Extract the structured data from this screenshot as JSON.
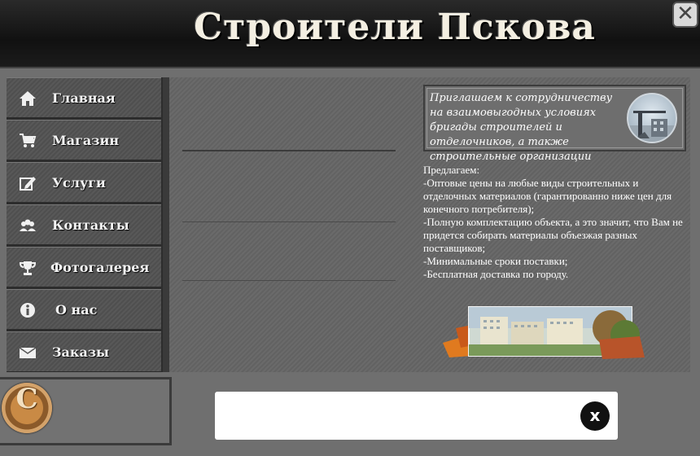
{
  "header": {
    "title": "Строители Пскова",
    "close_symbol": "✕"
  },
  "menu": [
    {
      "label": "Главная",
      "icon": "home-icon"
    },
    {
      "label": "Магазин",
      "icon": "cart-icon"
    },
    {
      "label": "Услуги",
      "icon": "edit-icon"
    },
    {
      "label": "Контакты",
      "icon": "users-icon"
    },
    {
      "label": "Фотогалерея",
      "icon": "trophy-icon"
    },
    {
      "label": "О нас",
      "icon": "info-icon"
    },
    {
      "label": "Заказы",
      "icon": "envelope-icon"
    }
  ],
  "invite": {
    "text": "Приглашаем к сотрудничеству на взаимовыгодных условиях бригады строителей и отделочников, а также строительные организации"
  },
  "offer": {
    "lines": [
      "Предлагаем:",
      "-Оптовые цены на любые виды строительных и отделочных материалов (гарантированно ниже цен для конечного потребителя);",
      "-Полную комплектацию объекта, а это значит, что Вам не придется собирать материалы объезжая разных поставщиков;",
      "-Минимальные сроки поставки;",
      "-Бесплатная доставка по городу."
    ]
  },
  "logo": {
    "letter": "C"
  },
  "popup": {
    "close_label": "x"
  },
  "colors": {
    "header_bg": "#111111",
    "menu_bg": "#555555",
    "content_bg": "#666666",
    "page_bg": "#6f6f6f"
  }
}
